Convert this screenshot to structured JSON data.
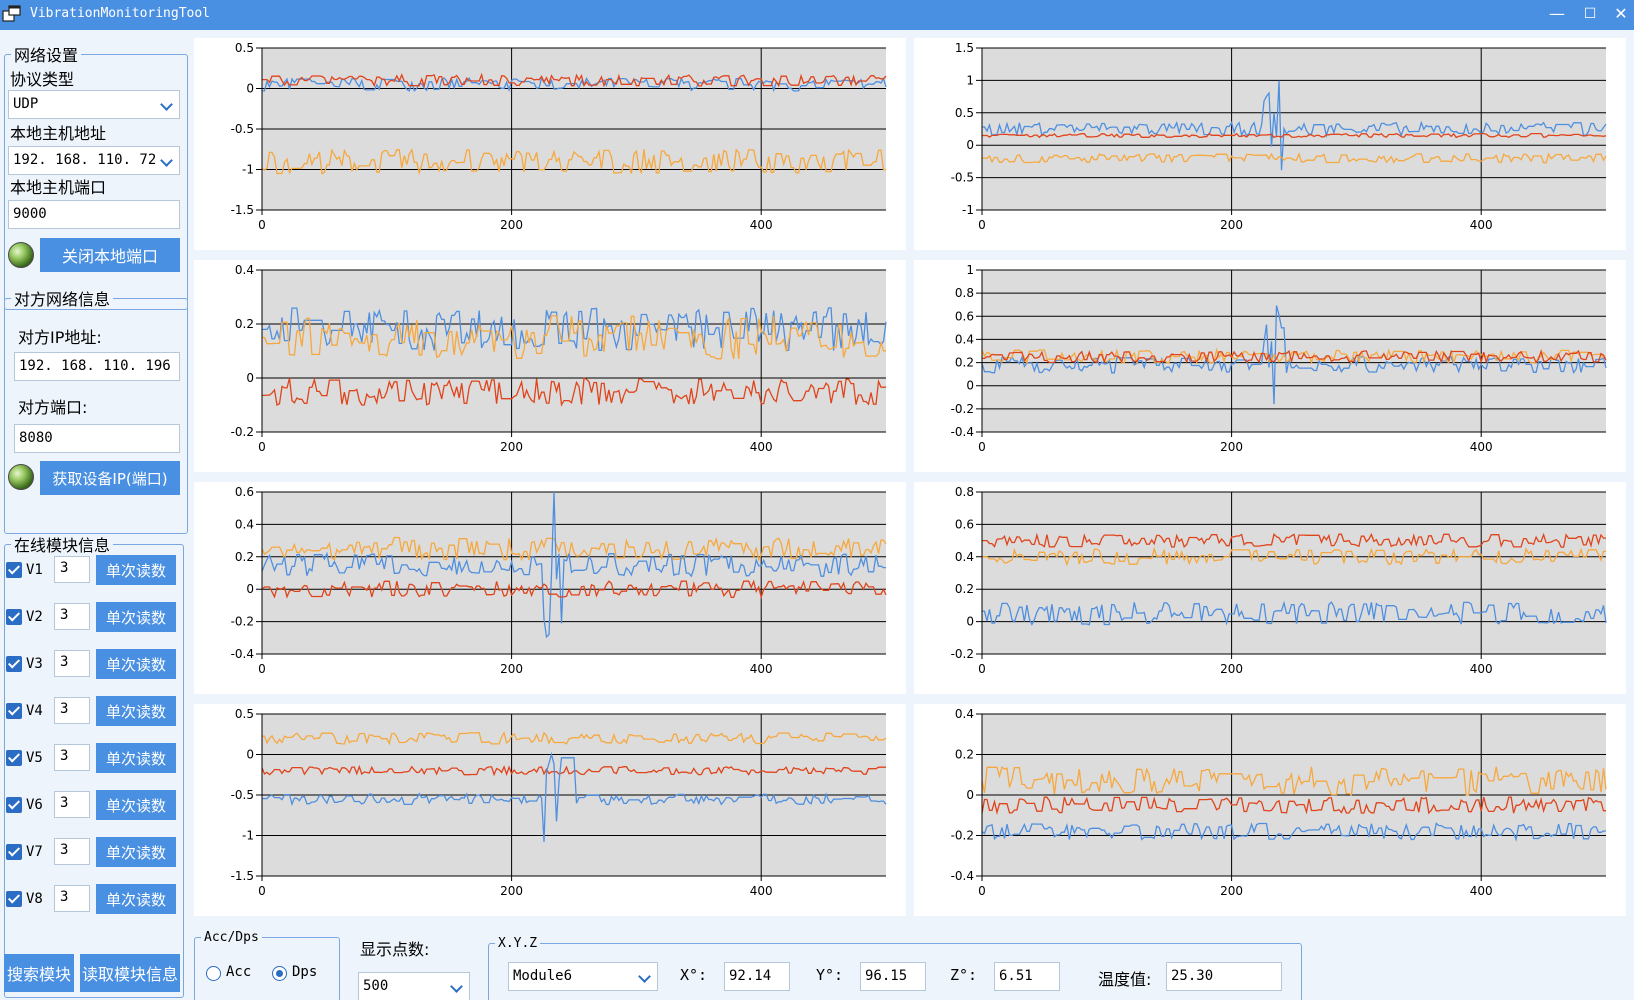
{
  "window": {
    "title": "VibrationMonitoringTool",
    "minimize": "—",
    "maximize": "☐",
    "close": "✕"
  },
  "network": {
    "legend": "网络设置",
    "protocol_label": "协议类型",
    "protocol_value": "UDP",
    "host_label": "本地主机地址",
    "host_value": "192. 168. 110. 72",
    "port_label": "本地主机端口",
    "port_value": "9000",
    "close_button": "关闭本地端口"
  },
  "remote": {
    "legend": "对方网络信息",
    "ip_label": "对方IP地址:",
    "ip_value": "192. 168. 110. 196",
    "port_label": "对方端口:",
    "port_value": "8080",
    "get_button": "获取设备IP(端口)"
  },
  "modules": {
    "legend": "在线模块信息",
    "read_label": "单次读数",
    "items": [
      {
        "name": "V1",
        "count": "3"
      },
      {
        "name": "V2",
        "count": "3"
      },
      {
        "name": "V3",
        "count": "3"
      },
      {
        "name": "V4",
        "count": "3"
      },
      {
        "name": "V5",
        "count": "3"
      },
      {
        "name": "V6",
        "count": "3"
      },
      {
        "name": "V7",
        "count": "3"
      },
      {
        "name": "V8",
        "count": "3"
      }
    ],
    "search_button": "搜索模块",
    "read_info_button": "读取模块信息"
  },
  "bottom": {
    "mode_legend": "Acc/Dps",
    "acc_label": "Acc",
    "dps_label": "Dps",
    "selected_mode": "Dps",
    "points_label": "显示点数:",
    "points_value": "500",
    "xyz_legend": "X.Y.Z",
    "module_value": "Module6",
    "x_label": "X°:",
    "x_value": "92.14",
    "y_label": "Y°:",
    "y_value": "96.15",
    "z_label": "Z°:",
    "z_value": "6.51",
    "temp_label": "温度值:",
    "temp_value": "25.30"
  },
  "colors": {
    "accent": "#4a90e2",
    "series_blue": "#4f8fe0",
    "series_red": "#e0441b",
    "series_orange": "#f6a83e",
    "plot_bg": "#dcdcdc"
  },
  "chart_data": [
    {
      "type": "line",
      "x_range": [
        0,
        500
      ],
      "x_ticks": [
        "0",
        "200",
        "400"
      ],
      "y_range": [
        -1.5,
        0.5
      ],
      "y_ticks": [
        "0.5",
        "0",
        "-0.5",
        "-1",
        "-1.5"
      ],
      "grid": true,
      "series": [
        {
          "color": "#4f8fe0",
          "mean": 0.05,
          "amp": 0.08
        },
        {
          "color": "#e0441b",
          "mean": 0.1,
          "amp": 0.07
        },
        {
          "color": "#f6a83e",
          "mean": -0.9,
          "amp": 0.15
        }
      ]
    },
    {
      "type": "line",
      "x_range": [
        0,
        500
      ],
      "x_ticks": [
        "0",
        "200",
        "400"
      ],
      "y_range": [
        -1,
        1.5
      ],
      "y_ticks": [
        "1.5",
        "1",
        "0.5",
        "0",
        "-0.5",
        "-1"
      ],
      "grid": true,
      "series": [
        {
          "color": "#4f8fe0",
          "mean": 0.25,
          "amp": 0.1,
          "spike": 0.8
        },
        {
          "color": "#e0441b",
          "mean": 0.15,
          "amp": 0.03
        },
        {
          "color": "#f6a83e",
          "mean": -0.2,
          "amp": 0.07
        }
      ]
    },
    {
      "type": "line",
      "x_range": [
        0,
        500
      ],
      "x_ticks": [
        "0",
        "200",
        "400"
      ],
      "y_range": [
        -0.2,
        0.4
      ],
      "y_ticks": [
        "0.4",
        "0.2",
        "0",
        "-0.2"
      ],
      "grid": true,
      "series": [
        {
          "color": "#4f8fe0",
          "mean": 0.18,
          "amp": 0.08
        },
        {
          "color": "#f6a83e",
          "mean": 0.15,
          "amp": 0.08
        },
        {
          "color": "#e0441b",
          "mean": -0.05,
          "amp": 0.05
        }
      ]
    },
    {
      "type": "line",
      "x_range": [
        0,
        500
      ],
      "x_ticks": [
        "0",
        "200",
        "400"
      ],
      "y_range": [
        -0.4,
        1
      ],
      "y_ticks": [
        "1",
        "0.8",
        "0.6",
        "0.4",
        "0.2",
        "0",
        "-0.2",
        "-0.4"
      ],
      "grid": true,
      "series": [
        {
          "color": "#4f8fe0",
          "mean": 0.18,
          "amp": 0.07,
          "spike": 0.6
        },
        {
          "color": "#f6a83e",
          "mean": 0.25,
          "amp": 0.06
        },
        {
          "color": "#e0441b",
          "mean": 0.25,
          "amp": 0.05
        }
      ]
    },
    {
      "type": "line",
      "x_range": [
        0,
        500
      ],
      "x_ticks": [
        "0",
        "200",
        "400"
      ],
      "y_range": [
        -0.4,
        0.6
      ],
      "y_ticks": [
        "0.6",
        "0.4",
        "0.2",
        "0",
        "-0.2",
        "-0.4"
      ],
      "grid": true,
      "series": [
        {
          "color": "#f6a83e",
          "mean": 0.25,
          "amp": 0.07
        },
        {
          "color": "#4f8fe0",
          "mean": 0.15,
          "amp": 0.07,
          "spike": -0.5
        },
        {
          "color": "#e0441b",
          "mean": 0.0,
          "amp": 0.05
        }
      ]
    },
    {
      "type": "line",
      "x_range": [
        0,
        500
      ],
      "x_ticks": [
        "0",
        "200",
        "400"
      ],
      "y_range": [
        -0.2,
        0.8
      ],
      "y_ticks": [
        "0.8",
        "0.6",
        "0.4",
        "0.2",
        "0",
        "-0.2"
      ],
      "grid": true,
      "series": [
        {
          "color": "#4f8fe0",
          "mean": 0.05,
          "amp": 0.07
        },
        {
          "color": "#f6a83e",
          "mean": 0.4,
          "amp": 0.05
        },
        {
          "color": "#e0441b",
          "mean": 0.5,
          "amp": 0.04
        }
      ]
    },
    {
      "type": "line",
      "x_range": [
        0,
        500
      ],
      "x_ticks": [
        "0",
        "200",
        "400"
      ],
      "y_range": [
        -1.5,
        0.5
      ],
      "y_ticks": [
        "0.5",
        "0",
        "-0.5",
        "-1",
        "-1.5"
      ],
      "grid": true,
      "series": [
        {
          "color": "#f6a83e",
          "mean": 0.2,
          "amp": 0.07
        },
        {
          "color": "#e0441b",
          "mean": -0.2,
          "amp": 0.05
        },
        {
          "color": "#4f8fe0",
          "mean": -0.55,
          "amp": 0.07,
          "spike": -0.8
        }
      ]
    },
    {
      "type": "line",
      "x_range": [
        0,
        500
      ],
      "x_ticks": [
        "0",
        "200",
        "400"
      ],
      "y_range": [
        -0.4,
        0.4
      ],
      "y_ticks": [
        "0.4",
        "0.2",
        "0",
        "-0.2",
        "-0.4"
      ],
      "grid": true,
      "series": [
        {
          "color": "#f6a83e",
          "mean": 0.07,
          "amp": 0.07
        },
        {
          "color": "#e0441b",
          "mean": -0.05,
          "amp": 0.04
        },
        {
          "color": "#4f8fe0",
          "mean": -0.18,
          "amp": 0.04
        }
      ]
    }
  ]
}
